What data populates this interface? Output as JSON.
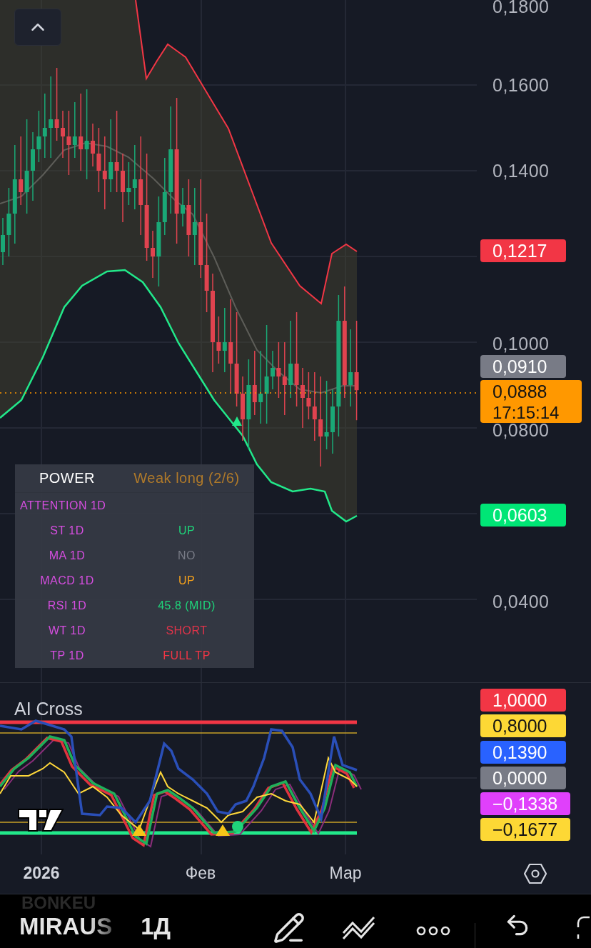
{
  "price_axis": {
    "ticks": [
      "0,1800",
      "0,1600",
      "0,1400",
      "0,1000",
      "0,0800",
      "0,0400"
    ],
    "markers": [
      {
        "value": "0,1217",
        "color": "#f23645"
      },
      {
        "value": "0,0910",
        "color": "#787b86"
      },
      {
        "value": "0,0888",
        "time": "17:15:14",
        "color": "#ff9800"
      },
      {
        "value": "0,0603",
        "color": "#00e676"
      }
    ]
  },
  "power_table": {
    "header_label": "POWER",
    "header_value": "Weak long (2/6)",
    "title": "ATTENTION 1D",
    "rows": [
      {
        "label": "ST 1D",
        "value": "UP",
        "color": "#1fd47a"
      },
      {
        "label": "MA 1D",
        "value": "NO",
        "color": "#787b86"
      },
      {
        "label": "MACD 1D",
        "value": "UP",
        "color": "#f7a21b"
      },
      {
        "label": "RSI 1D",
        "value": "45.8 (MID)",
        "color": "#1fd47a"
      },
      {
        "label": "WT 1D",
        "value": "SHORT",
        "color": "#e0344a"
      },
      {
        "label": "TP 1D",
        "value": "FULL TP",
        "color": "#f23645"
      }
    ]
  },
  "oscillator": {
    "title": "AI Cross",
    "markers": [
      {
        "value": "1,0000",
        "color": "#f23645"
      },
      {
        "value": "0,8000",
        "color": "#fdd835"
      },
      {
        "value": "0,1390",
        "color": "#2962ff"
      },
      {
        "value": "0,0000",
        "color": "#787b86"
      },
      {
        "value": "−0,1338",
        "color": "#e040fb"
      },
      {
        "value": "−0,1677",
        "color": "#fdd835"
      }
    ]
  },
  "time_axis": [
    "2026",
    "Фев",
    "Мар"
  ],
  "toolbar": {
    "faded_symbol": "BONKEU",
    "symbol": "MIRAUS",
    "interval": "1Д"
  }
}
